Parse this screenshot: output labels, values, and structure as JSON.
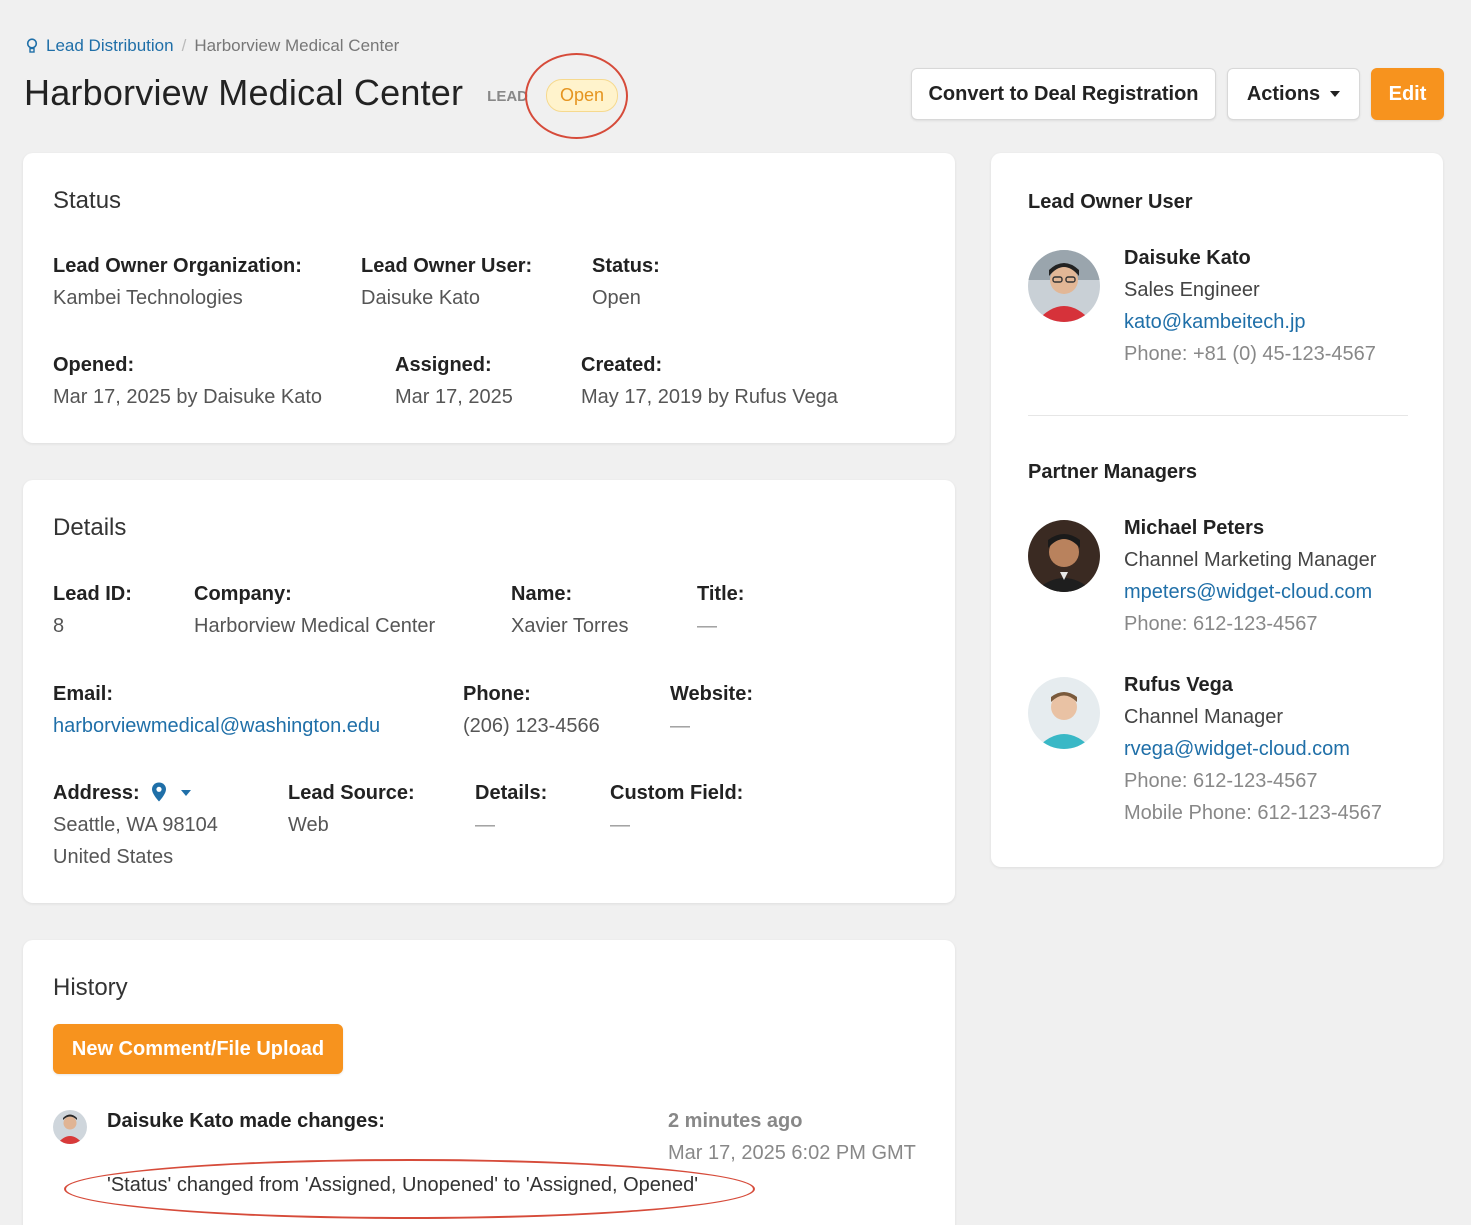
{
  "breadcrumb": {
    "parent": "Lead Distribution",
    "separator": "/",
    "current": "Harborview Medical Center"
  },
  "header": {
    "title": "Harborview Medical Center",
    "type_tag": "LEAD",
    "status": "Open",
    "convert_label": "Convert to Deal Registration",
    "actions_label": "Actions",
    "edit_label": "Edit"
  },
  "status_card": {
    "title": "Status",
    "lead_owner_org_label": "Lead Owner Organization:",
    "lead_owner_org": "Kambei Technologies",
    "lead_owner_user_label": "Lead Owner User:",
    "lead_owner_user": "Daisuke Kato",
    "status_label": "Status:",
    "status": "Open",
    "opened_label": "Opened:",
    "opened": "Mar 17, 2025 by Daisuke Kato",
    "assigned_label": "Assigned:",
    "assigned": "Mar 17, 2025",
    "created_label": "Created:",
    "created": "May 17, 2019 by Rufus Vega"
  },
  "details_card": {
    "title": "Details",
    "lead_id_label": "Lead ID:",
    "lead_id": "8",
    "company_label": "Company:",
    "company": "Harborview Medical Center",
    "name_label": "Name:",
    "name": "Xavier Torres",
    "title_label": "Title:",
    "title_value": "—",
    "email_label": "Email:",
    "email": "harborviewmedical@washington.edu",
    "phone_label": "Phone:",
    "phone": "(206) 123-4566",
    "website_label": "Website:",
    "website": "—",
    "address_label": "Address:",
    "address_line1": "Seattle, WA 98104",
    "address_line2": "United States",
    "lead_source_label": "Lead Source:",
    "lead_source": "Web",
    "details_label": "Details:",
    "details": "—",
    "custom_field_label": "Custom Field:",
    "custom_field": "—"
  },
  "history_card": {
    "title": "History",
    "new_comment_label": "New Comment/File Upload",
    "entries": [
      {
        "author": "Daisuke Kato made changes:",
        "relative_time": "2 minutes ago",
        "date": "Mar 17, 2025 6:02 PM GMT",
        "change": "'Status' changed from 'Assigned, Unopened' to 'Assigned, Opened'"
      }
    ]
  },
  "sidebar": {
    "owner_title": "Lead Owner User",
    "owner": {
      "name": "Daisuke Kato",
      "role": "Sales Engineer",
      "email": "kato@kambeitech.jp",
      "phone": "Phone: +81 (0) 45-123-4567"
    },
    "managers_title": "Partner Managers",
    "managers": [
      {
        "name": "Michael Peters",
        "role": "Channel Marketing Manager",
        "email": "mpeters@widget-cloud.com",
        "phone": "Phone: 612-123-4567"
      },
      {
        "name": "Rufus Vega",
        "role": "Channel Manager",
        "email": "rvega@widget-cloud.com",
        "phone": "Phone: 612-123-4567",
        "mobile": "Mobile Phone: 612-123-4567"
      }
    ]
  },
  "colors": {
    "accent": "#f7931e",
    "link": "#1f6fa8",
    "annotation": "#d64b3a",
    "status_pill_bg": "#fff3cc"
  }
}
